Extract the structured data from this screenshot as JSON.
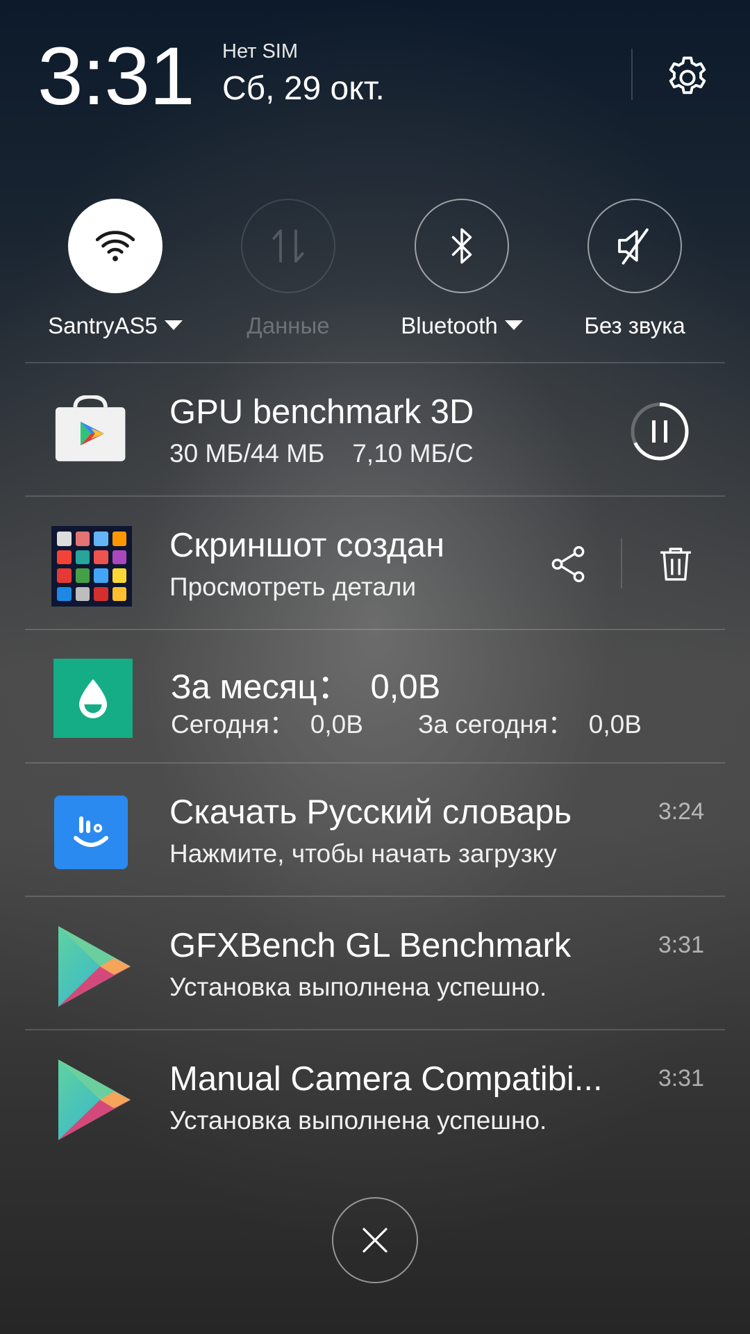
{
  "header": {
    "time": "3:31",
    "sim_status": "Нет SIM",
    "date": "Сб, 29 окт.",
    "settings_icon": "gear-icon"
  },
  "toggles": [
    {
      "label": "SantryAS5",
      "icon": "wifi-icon",
      "state": "on",
      "has_dropdown": true
    },
    {
      "label": "Данные",
      "icon": "mobile-data-icon",
      "state": "disabled",
      "has_dropdown": false
    },
    {
      "label": "Bluetooth",
      "icon": "bluetooth-icon",
      "state": "off",
      "has_dropdown": true
    },
    {
      "label": "Без звука",
      "icon": "mute-icon",
      "state": "off",
      "has_dropdown": false
    }
  ],
  "notifications": [
    {
      "app_icon": "play-store-icon",
      "title": "GPU benchmark 3D",
      "progress": "30 МБ/44 МБ",
      "speed": "7,10 МБ/С",
      "download_fraction": 0.68,
      "action_icon": "pause-icon"
    },
    {
      "app_icon": "screenshot-thumbnail",
      "title": "Скриншот создан",
      "subtitle": "Просмотреть детали",
      "actions": [
        "share-icon",
        "delete-icon"
      ]
    },
    {
      "app_icon": "water-drop-icon",
      "title_label": "За месяц：",
      "title_value": "0,0B",
      "today_label": "Сегодня：",
      "today_value": "0,0B",
      "for_today_label": "За сегодня：",
      "for_today_value": "0,0B"
    },
    {
      "app_icon": "touchpal-keyboard-icon",
      "title": "Скачать Русский словарь",
      "subtitle": "Нажмите, чтобы начать загрузку",
      "time": "3:24"
    },
    {
      "app_icon": "play-triangle-icon",
      "title": "GFXBench GL Benchmark",
      "subtitle": "Установка выполнена успешно.",
      "time": "3:31"
    },
    {
      "app_icon": "play-triangle-icon",
      "title": "Manual Camera Compatibi...",
      "subtitle": "Установка выполнена успешно.",
      "time": "3:31"
    }
  ],
  "footer": {
    "close_icon": "close-icon"
  },
  "colors": {
    "accent_green": "#14ad85",
    "keyboard_blue": "#2a8af0",
    "play_green": "#4fd6a5",
    "play_orange": "#f6a45a",
    "play_pink": "#d34a7a"
  }
}
